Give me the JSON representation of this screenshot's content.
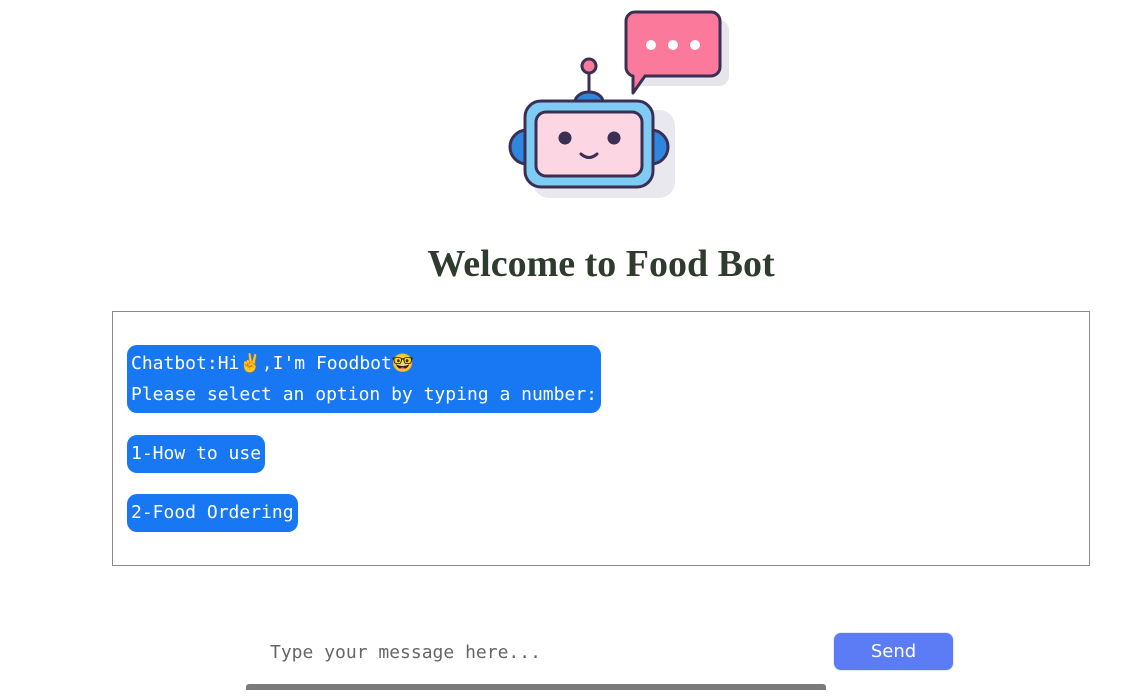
{
  "header": {
    "logo_icon": "robot-chat-icon",
    "title": "Welcome to Food Bot"
  },
  "chat": {
    "greeting_line1": "Chatbot:Hi✌️,I'm Foodbot🤓",
    "greeting_line2": "Please select an option by typing a number:",
    "option1": "1-How to use",
    "option2": "2-Food Ordering"
  },
  "composer": {
    "placeholder": "Type your message here...",
    "send_label": "Send"
  },
  "colors": {
    "bubble": "#1877f2",
    "send_button": "#5b7cf5",
    "title": "#2f3b2f"
  }
}
